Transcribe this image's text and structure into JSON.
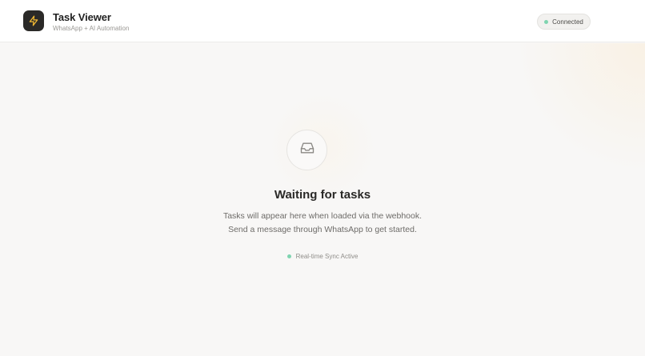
{
  "header": {
    "title": "Task Viewer",
    "subtitle": "WhatsApp + AI Automation",
    "logo_icon": "lightning-bolt-icon",
    "status": {
      "label": "Connected",
      "color": "#7fd4b0"
    }
  },
  "empty_state": {
    "icon": "inbox-icon",
    "heading": "Waiting for tasks",
    "line1": "Tasks will appear here when loaded via the webhook.",
    "line2": "Send a message through WhatsApp to get started.",
    "sync_label": "Real-time Sync Active",
    "sync_color": "#7fd4b0"
  },
  "colors": {
    "logo_bg": "#2b2a28",
    "logo_bolt": "#f2b933",
    "background": "#f8f7f6"
  }
}
